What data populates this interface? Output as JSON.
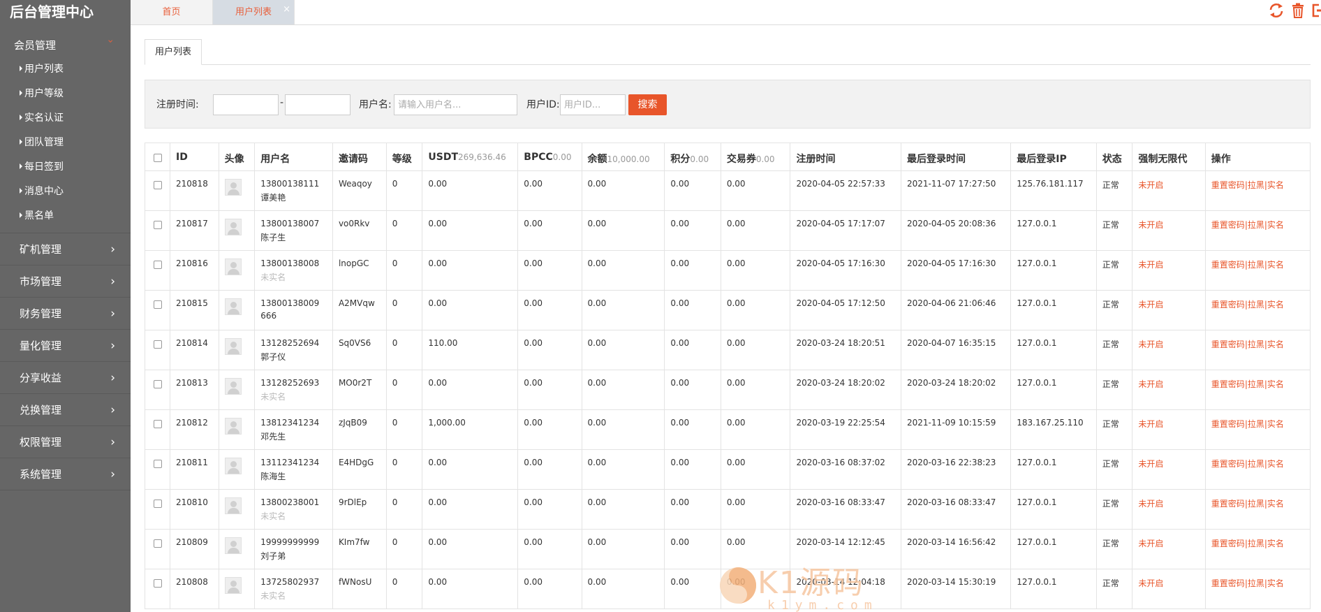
{
  "brand": "后台管理中心",
  "top_tabs": {
    "home": "首页",
    "active": "用户列表",
    "close_glyph": "×"
  },
  "sidebar": {
    "open_group": "会员管理",
    "sub_items": [
      "用户列表",
      "用户等级",
      "实名认证",
      "团队管理",
      "每日签到",
      "消息中心",
      "黑名单"
    ],
    "groups": [
      "矿机管理",
      "市场管理",
      "财务管理",
      "量化管理",
      "分享收益",
      "兑换管理",
      "权限管理",
      "系统管理"
    ]
  },
  "panel_tab": "用户列表",
  "filter": {
    "reg_time_label": "注册时间:",
    "dash": "-",
    "username_label": "用户名:",
    "username_placeholder": "请输入用户名...",
    "userid_label": "用户ID:",
    "userid_placeholder": "用户ID...",
    "search_button": "搜索"
  },
  "table": {
    "headers": {
      "id": "ID",
      "avatar": "头像",
      "username": "用户名",
      "invite": "邀请码",
      "level": "等级",
      "usdt": "USDT",
      "usdt_sum": "269,636.46",
      "bpcc": "BPCC",
      "bpcc_sum": "0.00",
      "balance": "余额",
      "balance_sum": "10,000.00",
      "points": "积分",
      "points_sum": "0.00",
      "voucher": "交易券",
      "voucher_sum": "0.00",
      "reg_time": "注册时间",
      "last_login": "最后登录时间",
      "last_ip": "最后登录IP",
      "status": "状态",
      "force": "强制无限代",
      "ops": "操作"
    },
    "rows": [
      {
        "id": "210818",
        "phone": "13800138111",
        "name": "谭美艳",
        "name_muted": false,
        "invite": "Weaqoy",
        "level": "0",
        "usdt": "0.00",
        "bpcc": "0.00",
        "balance": "0.00",
        "points": "0.00",
        "voucher": "0.00",
        "reg": "2020-04-05 22:57:33",
        "login": "2021-11-07 17:27:50",
        "ip": "125.76.181.117",
        "status": "正常",
        "force": "未开启"
      },
      {
        "id": "210817",
        "phone": "13800138007",
        "name": "陈子生",
        "name_muted": false,
        "invite": "vo0Rkv",
        "level": "0",
        "usdt": "0.00",
        "bpcc": "0.00",
        "balance": "0.00",
        "points": "0.00",
        "voucher": "0.00",
        "reg": "2020-04-05 17:17:07",
        "login": "2020-04-05 20:08:36",
        "ip": "127.0.0.1",
        "status": "正常",
        "force": "未开启"
      },
      {
        "id": "210816",
        "phone": "13800138008",
        "name": "未实名",
        "name_muted": true,
        "invite": "lnopGC",
        "level": "0",
        "usdt": "0.00",
        "bpcc": "0.00",
        "balance": "0.00",
        "points": "0.00",
        "voucher": "0.00",
        "reg": "2020-04-05 17:16:30",
        "login": "2020-04-05 17:16:30",
        "ip": "127.0.0.1",
        "status": "正常",
        "force": "未开启"
      },
      {
        "id": "210815",
        "phone": "13800138009",
        "name": "666",
        "name_muted": false,
        "invite": "A2MVqw",
        "level": "0",
        "usdt": "0.00",
        "bpcc": "0.00",
        "balance": "0.00",
        "points": "0.00",
        "voucher": "0.00",
        "reg": "2020-04-05 17:12:50",
        "login": "2020-04-06 21:06:46",
        "ip": "127.0.0.1",
        "status": "正常",
        "force": "未开启"
      },
      {
        "id": "210814",
        "phone": "13128252694",
        "name": "郭子仪",
        "name_muted": false,
        "invite": "Sq0VS6",
        "level": "0",
        "usdt": "110.00",
        "bpcc": "0.00",
        "balance": "0.00",
        "points": "0.00",
        "voucher": "0.00",
        "reg": "2020-03-24 18:20:51",
        "login": "2020-04-07 16:35:15",
        "ip": "127.0.0.1",
        "status": "正常",
        "force": "未开启"
      },
      {
        "id": "210813",
        "phone": "13128252693",
        "name": "未实名",
        "name_muted": true,
        "invite": "MO0r2T",
        "level": "0",
        "usdt": "0.00",
        "bpcc": "0.00",
        "balance": "0.00",
        "points": "0.00",
        "voucher": "0.00",
        "reg": "2020-03-24 18:20:02",
        "login": "2020-03-24 18:20:02",
        "ip": "127.0.0.1",
        "status": "正常",
        "force": "未开启"
      },
      {
        "id": "210812",
        "phone": "13812341234",
        "name": "邓先生",
        "name_muted": false,
        "invite": "zJqB09",
        "level": "0",
        "usdt": "1,000.00",
        "bpcc": "0.00",
        "balance": "0.00",
        "points": "0.00",
        "voucher": "0.00",
        "reg": "2020-03-19 22:25:54",
        "login": "2021-11-09 10:15:59",
        "ip": "183.167.25.110",
        "status": "正常",
        "force": "未开启"
      },
      {
        "id": "210811",
        "phone": "13112341234",
        "name": "陈海生",
        "name_muted": false,
        "invite": "E4HDgG",
        "level": "0",
        "usdt": "0.00",
        "bpcc": "0.00",
        "balance": "0.00",
        "points": "0.00",
        "voucher": "0.00",
        "reg": "2020-03-16 08:37:02",
        "login": "2020-03-16 22:38:23",
        "ip": "127.0.0.1",
        "status": "正常",
        "force": "未开启"
      },
      {
        "id": "210810",
        "phone": "13800238001",
        "name": "未实名",
        "name_muted": true,
        "invite": "9rDlEp",
        "level": "0",
        "usdt": "0.00",
        "bpcc": "0.00",
        "balance": "0.00",
        "points": "0.00",
        "voucher": "0.00",
        "reg": "2020-03-16 08:33:47",
        "login": "2020-03-16 08:33:47",
        "ip": "127.0.0.1",
        "status": "正常",
        "force": "未开启"
      },
      {
        "id": "210809",
        "phone": "19999999999",
        "name": "刘子弟",
        "name_muted": false,
        "invite": "KIm7fw",
        "level": "0",
        "usdt": "0.00",
        "bpcc": "0.00",
        "balance": "0.00",
        "points": "0.00",
        "voucher": "0.00",
        "reg": "2020-03-14 12:12:45",
        "login": "2020-03-14 16:56:42",
        "ip": "127.0.0.1",
        "status": "正常",
        "force": "未开启"
      },
      {
        "id": "210808",
        "phone": "13725802937",
        "name": "未实名",
        "name_muted": true,
        "invite": "fWNosU",
        "level": "0",
        "usdt": "0.00",
        "bpcc": "0.00",
        "balance": "0.00",
        "points": "0.00",
        "voucher": "0.00",
        "reg": "2020-03-14 12:04:18",
        "login": "2020-03-14 15:30:19",
        "ip": "127.0.0.1",
        "status": "正常",
        "force": "未开启"
      }
    ],
    "ops": {
      "reset": "重置密码",
      "sep": "|",
      "block": "拉黑",
      "realname": "实名"
    }
  },
  "watermark": {
    "main": "K1源码",
    "sub": "k1ym.com"
  },
  "icons": {
    "refresh": "refresh-icon",
    "trash": "trash-icon",
    "logout": "logout-icon"
  },
  "colors": {
    "accent": "#e8552a",
    "sidebar": "#666666"
  }
}
